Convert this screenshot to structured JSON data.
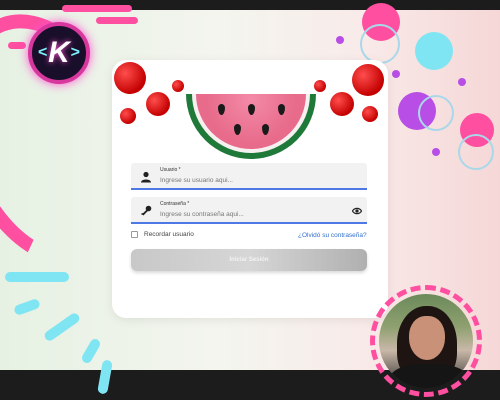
{
  "colors": {
    "accent_pink": "#ff4fa0",
    "accent_blue": "#4e78e6",
    "link_blue": "#2f6fcf",
    "cyan": "#7fe5f2",
    "magenta": "#b84ee6"
  },
  "branding": {
    "logo_letter": "K",
    "logo_left_chevron": "<",
    "logo_right_chevron": ">"
  },
  "form": {
    "username": {
      "label": "Usuario *",
      "placeholder": "Ingrese su usuario aqui...",
      "value": "",
      "icon": "user-icon"
    },
    "password": {
      "label": "Contraseña *",
      "placeholder": "Ingrese su contraseña aqui...",
      "value": "",
      "icon": "key-icon",
      "toggle_icon": "eye-icon"
    },
    "remember_label": "Recordar usuario",
    "remember_checked": false,
    "forgot_link": "¿Olvidó su contraseña?",
    "submit_label": "Iniciar Sesión"
  }
}
